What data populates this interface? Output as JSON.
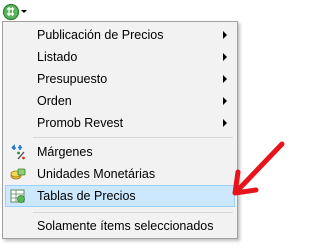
{
  "toolbar": {
    "button_icon": "dollar-price-icon",
    "dropdown_icon": "chevron-down-icon"
  },
  "menu": {
    "items": [
      {
        "label": "Publicación de Precios",
        "submenu": true
      },
      {
        "label": "Listado",
        "submenu": true
      },
      {
        "label": "Presupuesto",
        "submenu": true
      },
      {
        "label": "Orden",
        "submenu": true
      },
      {
        "label": "Promob Revest",
        "submenu": true
      },
      {
        "label": "Márgenes",
        "icon": "margin-percent-icon"
      },
      {
        "label": "Unidades Monetárias",
        "icon": "coins-icon"
      },
      {
        "label": "Tablas de Precios",
        "icon": "price-table-icon",
        "highlighted": true
      },
      {
        "label": "Solamente ítems seleccionados"
      }
    ]
  },
  "colors": {
    "highlight_bg": "#cce8ff",
    "highlight_border": "#99d1ff",
    "annotation_arrow": "#e8131b",
    "menu_bg": "#f2f2f2"
  }
}
